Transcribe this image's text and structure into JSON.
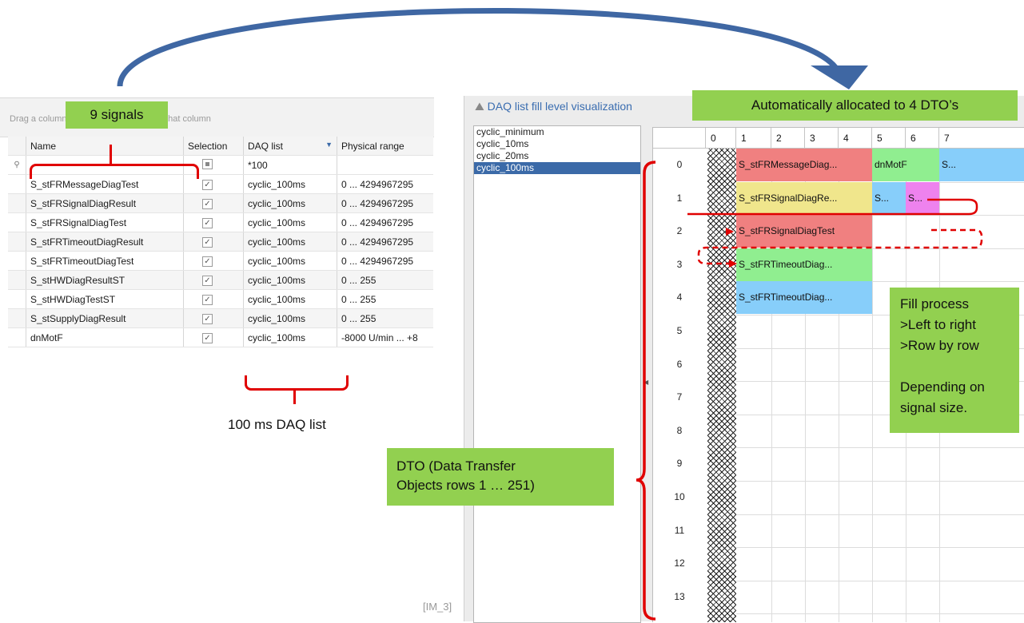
{
  "left_grid": {
    "group_hint": "Drag a column header here to group by that column",
    "columns": [
      "Name",
      "Selection",
      "DAQ list",
      "Physical range"
    ],
    "filter_daq": "*100",
    "rows": [
      {
        "name": "S_stFRMessageDiagTest",
        "daq": "cyclic_100ms",
        "range": "0 ... 4294967295"
      },
      {
        "name": "S_stFRSignalDiagResult",
        "daq": "cyclic_100ms",
        "range": "0 ... 4294967295"
      },
      {
        "name": "S_stFRSignalDiagTest",
        "daq": "cyclic_100ms",
        "range": "0 ... 4294967295"
      },
      {
        "name": "S_stFRTimeoutDiagResult",
        "daq": "cyclic_100ms",
        "range": "0 ... 4294967295"
      },
      {
        "name": "S_stFRTimeoutDiagTest",
        "daq": "cyclic_100ms",
        "range": "0 ... 4294967295"
      },
      {
        "name": "S_stHWDiagResultST",
        "daq": "cyclic_100ms",
        "range": "0 ... 255"
      },
      {
        "name": "S_stHWDiagTestST",
        "daq": "cyclic_100ms",
        "range": "0 ... 255"
      },
      {
        "name": "S_stSupplyDiagResult",
        "daq": "cyclic_100ms",
        "range": "0 ... 255"
      },
      {
        "name": "dnMotF",
        "daq": "cyclic_100ms",
        "range": "-8000 U/min ... +8"
      }
    ]
  },
  "annotations": {
    "signals": "9 signals",
    "daq_list": "100 ms DAQ list",
    "allocated": "Automatically  allocated to 4  DTO’s",
    "dto_line1": "DTO (Data Transfer",
    "dto_line2": "Objects rows 1 … 251)",
    "fill_lines": [
      "Fill process",
      ">Left to right",
      ">Row by row",
      "",
      "Depending on",
      "signal size."
    ],
    "ref": "[IM_3]"
  },
  "right_panel": {
    "title": "DAQ list fill level visualization",
    "daq_lists": [
      "cyclic_minimum",
      "cyclic_10ms",
      "cyclic_20ms",
      "cyclic_100ms"
    ],
    "selected": "cyclic_100ms",
    "columns": [
      "0",
      "1",
      "2",
      "3",
      "4",
      "5",
      "6",
      "7"
    ],
    "row_numbers": [
      "0",
      "1",
      "2",
      "3",
      "4",
      "5",
      "6",
      "7",
      "8",
      "9",
      "10",
      "11",
      "12",
      "13"
    ],
    "cells": [
      {
        "row": 0,
        "col": 1,
        "span": 4,
        "label": "S_stFRMessageDiag...",
        "color": "#f08080"
      },
      {
        "row": 0,
        "col": 5,
        "span": 2,
        "label": "dnMotF",
        "color": "#90ee90"
      },
      {
        "row": 0,
        "col": 7,
        "span": 1,
        "label": "S...",
        "color": "#87cefa"
      },
      {
        "row": 1,
        "col": 1,
        "span": 4,
        "label": "S_stFRSignalDiagRe...",
        "color": "#f0e68c"
      },
      {
        "row": 1,
        "col": 5,
        "span": 1,
        "label": "S...",
        "color": "#87cefa"
      },
      {
        "row": 1,
        "col": 6,
        "span": 1,
        "label": "S...",
        "color": "#ee82ee"
      },
      {
        "row": 2,
        "col": 1,
        "span": 4,
        "label": "S_stFRSignalDiagTest",
        "color": "#f08080"
      },
      {
        "row": 3,
        "col": 1,
        "span": 4,
        "label": "S_stFRTimeoutDiag...",
        "color": "#90ee90"
      },
      {
        "row": 4,
        "col": 1,
        "span": 4,
        "label": "S_stFRTimeoutDiag...",
        "color": "#87cefa"
      }
    ]
  },
  "colors": {
    "accent_green": "#92d050",
    "bracket_red": "#e00000",
    "arrow_blue": "#3f67a3"
  }
}
